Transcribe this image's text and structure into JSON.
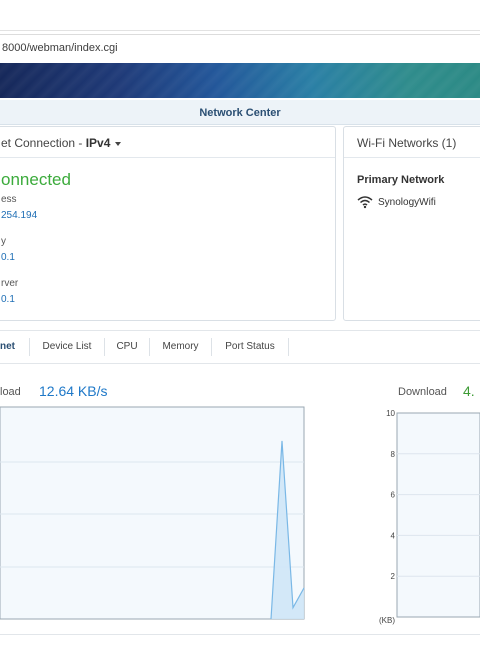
{
  "browser": {
    "url": "8000/webman/index.cgi"
  },
  "window": {
    "title": "Network Center"
  },
  "connection": {
    "title": "et Connection - ",
    "protocol": "IPv4",
    "status": "onnected",
    "fields": [
      {
        "label": "ess",
        "value": "254.194"
      },
      {
        "label": "y",
        "value": "0.1"
      },
      {
        "label": "rver",
        "value": "0.1"
      }
    ]
  },
  "wifi": {
    "title": "Wi-Fi Networks (1)",
    "primary_label": "Primary Network",
    "ssid": "SynologyWifi",
    "icon": "wifi-icon"
  },
  "tabs": [
    {
      "label": "net",
      "active": true
    },
    {
      "label": "Device List",
      "active": false
    },
    {
      "label": "CPU",
      "active": false
    },
    {
      "label": "Memory",
      "active": false
    },
    {
      "label": "Port Status",
      "active": false
    }
  ],
  "left_chart": {
    "label": "load",
    "value": "12.64 KB/s"
  },
  "right_chart": {
    "label": "Download",
    "value": "4."
  },
  "colors": {
    "accent": "#2b4f73",
    "connected": "#3cab3c",
    "link": "#1e6eb5",
    "chart_line": "#7ab8e6",
    "chart_fill": "#cfe6f7"
  },
  "chart_data": [
    {
      "type": "area",
      "title": "",
      "xlabel": "",
      "ylabel": "",
      "y_tick_labels": [],
      "grid": true,
      "x": [
        0,
        1,
        2,
        3,
        4,
        5,
        6,
        7,
        8,
        9,
        10,
        11,
        12,
        13,
        14,
        15,
        16,
        17,
        18,
        19,
        20
      ],
      "series": [
        {
          "values": [
            0,
            0,
            0,
            0,
            0,
            0,
            0,
            0,
            0,
            0,
            0,
            0,
            0,
            0,
            0,
            0,
            0,
            0,
            12.6,
            0.8,
            2.2
          ]
        }
      ]
    },
    {
      "type": "area",
      "title": "",
      "xlabel": "",
      "ylabel": "(KB)",
      "ylim": [
        0,
        10
      ],
      "y_ticks": [
        2,
        4,
        6,
        8,
        10
      ],
      "grid": true,
      "x": [],
      "series": []
    }
  ]
}
